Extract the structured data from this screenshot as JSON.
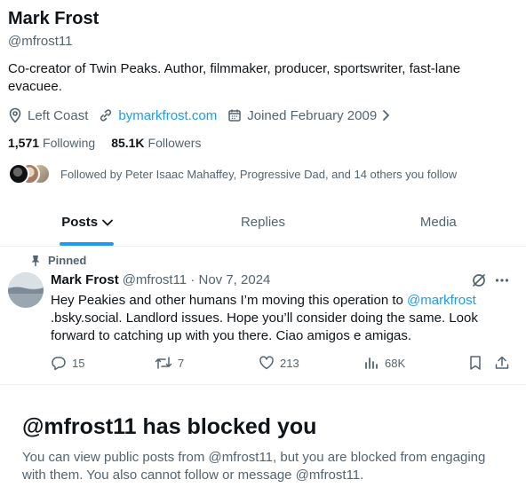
{
  "profile": {
    "name": "Mark Frost",
    "handle": "@mfrost11",
    "bio": "Co-creator of Twin Peaks. Author, filmmaker, producer, sportswriter, fast-lane evacuee.",
    "location": "Left Coast",
    "website": "bymarkfrost.com",
    "joined": "Joined February 2009",
    "following_count": "1,571",
    "following_label": "Following",
    "followers_count": "85.1K",
    "followers_label": "Followers",
    "followed_by": "Followed by Peter Isaac Mahaffey, Progressive Dad, and 14 others you follow"
  },
  "tabs": [
    {
      "label": "Posts"
    },
    {
      "label": "Replies"
    },
    {
      "label": "Media"
    }
  ],
  "post": {
    "pinned_label": "Pinned",
    "author_name": "Mark Frost",
    "author_handle_date": "@mfrost11 · Nov 7, 2024",
    "text_before_mention": "Hey Peakies and other humans I’m moving this operation to ",
    "mention": "@markfrost",
    "text_after_mention": ".bsky.social. Landlord issues. Hope you’ll consider doing the same. Look forward to catching up with you there. Ciao amigos e amigas.",
    "replies": "15",
    "reposts": "7",
    "likes": "213",
    "views": "68K"
  },
  "blocked": {
    "title": "@mfrost11 has blocked you",
    "message": "You can view public posts from @mfrost11, but you are blocked from engaging with them. You also cannot follow or message @mfrost11."
  },
  "colors": {
    "accent": "#1d9bf0",
    "secondary_text": "#536471",
    "primary_text": "#0f1419"
  }
}
